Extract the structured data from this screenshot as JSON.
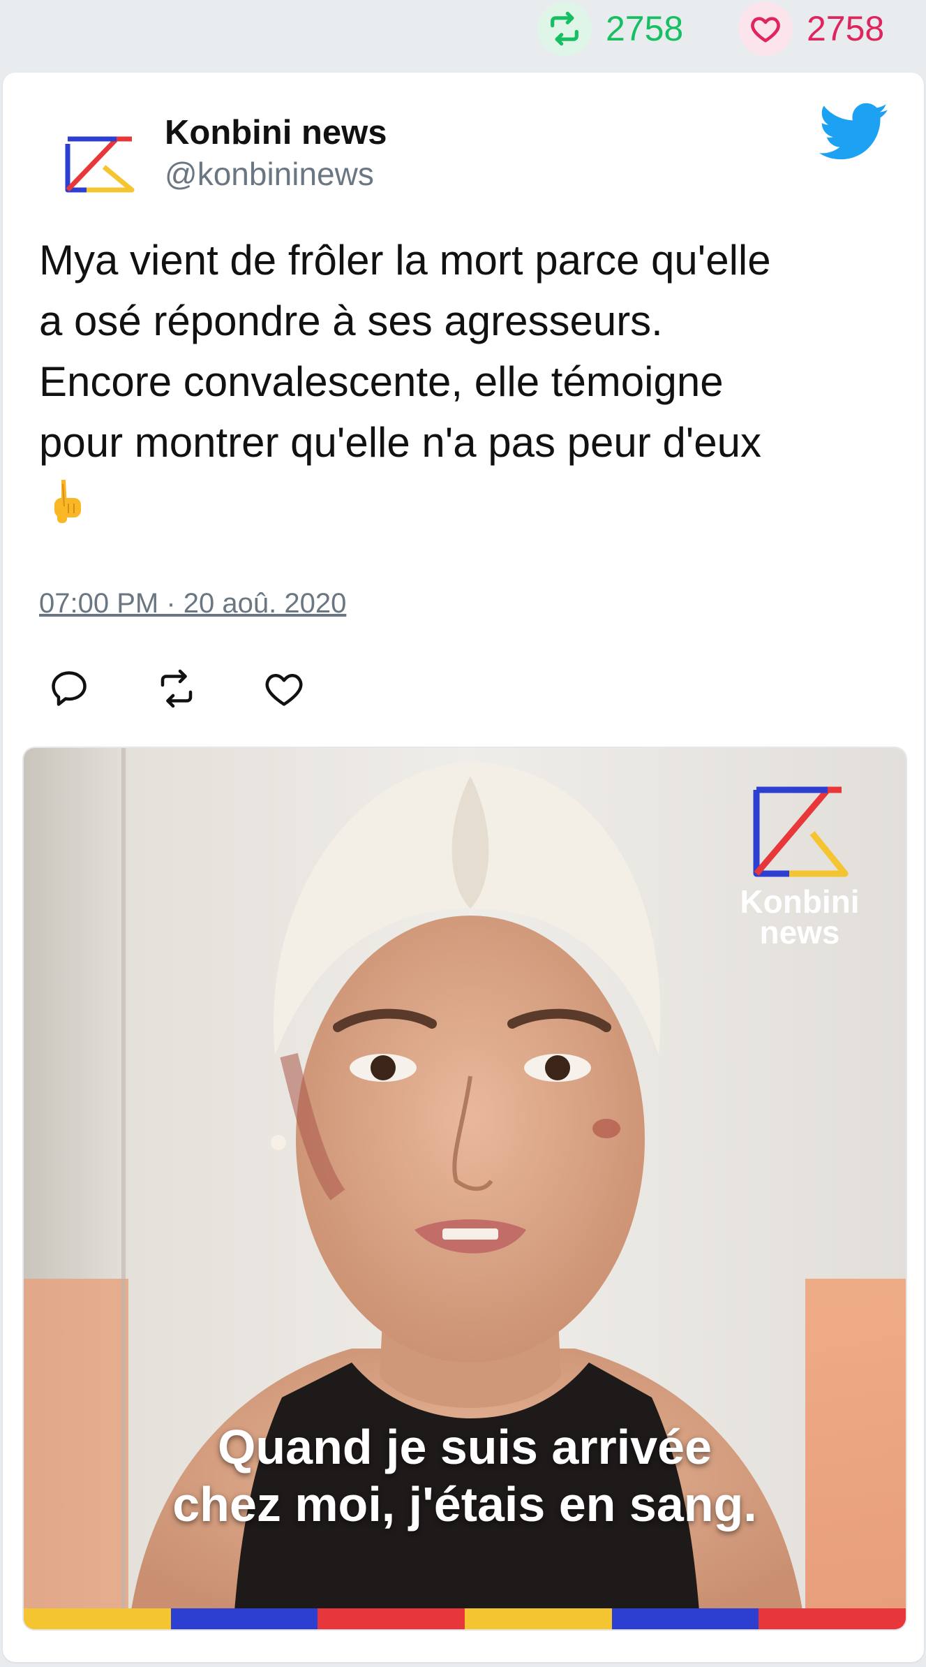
{
  "stats": {
    "retweets": "2758",
    "likes": "2758",
    "retweet_icon": "retweet-icon",
    "like_icon": "heart-icon",
    "retweet_color": "#17bf63",
    "like_color": "#e0245e"
  },
  "author": {
    "name": "Konbini news",
    "handle": "@konbininews",
    "avatar_icon": "konbini-logo"
  },
  "tweet": {
    "lines": [
      "Mya vient de frôler la mort parce qu'elle",
      "a osé répondre à ses agresseurs.",
      "Encore convalescente, elle témoigne",
      "pour montrer qu'elle n'a pas peur d'eux"
    ],
    "emoji": "pointing-down-emoji",
    "timestamp": "07:00 PM · 20 aoû. 2020"
  },
  "actions": [
    "reply-icon",
    "retweet-icon",
    "like-icon"
  ],
  "media": {
    "watermark": [
      "Konbini",
      "news"
    ],
    "caption": [
      "Quand je suis arrivée",
      "chez moi, j'étais en sang."
    ],
    "stripe_colors": [
      "#f5c431",
      "#2c3fd1",
      "#e8373a",
      "#f5c431",
      "#2c3fd1",
      "#e8373a"
    ]
  },
  "colors": {
    "twitter_blue": "#1da1f2",
    "text": "#111111",
    "muted": "#6a7783"
  }
}
